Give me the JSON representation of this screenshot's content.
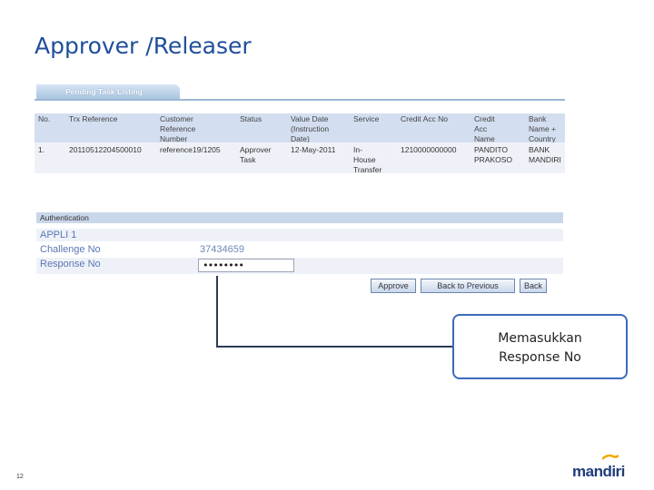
{
  "slide": {
    "title": "Approver /Releaser",
    "page_number": "12",
    "logo_text": "mandiri"
  },
  "tab": {
    "label": "Pending Task Listing"
  },
  "task_table": {
    "headers": [
      [
        "No."
      ],
      [
        "Trx Reference"
      ],
      [
        "Customer",
        "Reference",
        "Number"
      ],
      [
        "Status"
      ],
      [
        "Value Date",
        "(Instruction",
        "Date)"
      ],
      [
        "Service"
      ],
      [
        "Credit Acc No"
      ],
      [
        "Credit",
        "Acc",
        "Name"
      ],
      [
        "Bank",
        "Name +",
        "Country"
      ]
    ],
    "row": [
      [
        "1."
      ],
      [
        "20110512204500010"
      ],
      [
        "reference19/1205"
      ],
      [
        "Approver",
        "Task"
      ],
      [
        "12-May-2011"
      ],
      [
        "In-",
        "House",
        "Transfer"
      ],
      [
        "1210000000000"
      ],
      [
        "PANDITO",
        "PRAKOSO"
      ],
      [
        "BANK",
        "MANDIRI"
      ]
    ]
  },
  "auth": {
    "header": "Authentication",
    "appli_label": "APPLI 1",
    "challenge_label": "Challenge No",
    "challenge_value": "37434659",
    "response_label": "Response No",
    "response_value": "••••••••"
  },
  "buttons": {
    "approve": "Approve",
    "back_previous": "Back to Previous",
    "back": "Back"
  },
  "callout": {
    "line1": "Memasukkan",
    "line2": "Response No"
  }
}
